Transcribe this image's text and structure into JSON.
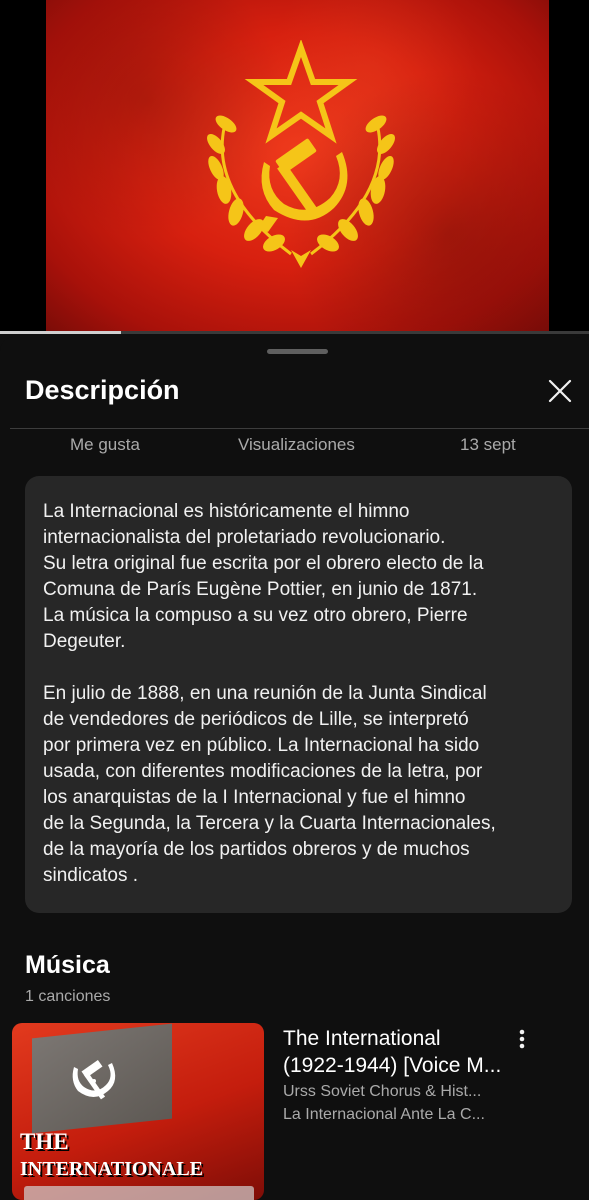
{
  "video": {
    "progress_fraction": 0.205,
    "thumbnail_icon": "hammer-and-sickle-icon"
  },
  "sheet": {
    "title": "Descripción",
    "close_icon": "close-icon"
  },
  "stats": {
    "likes_label": "Me gusta",
    "views_label": "Visualizaciones",
    "date": "13 sept"
  },
  "description": {
    "paragraphs": [
      "La Internacional es históricamente el himno internacionalista del proletariado revolucionario. Su letra original fue escrita por el obrero electo de la Comuna de París Eugène Pottier, en junio de 1871. La música la compuso a su vez otro obrero, Pierre Degeuter.",
      "En julio de 1888, en una reunión de la Junta Sindical de vendedores de periódicos de Lille, se interpretó por primera vez en público. La Internacional ha sido usada, con diferentes modificaciones de la letra, por los anarquistas de la I Internacional y fue el himno de la Segunda, la Tercera y la Cuarta Internacionales, de la mayoría de los partidos obreros y de muchos sindicatos ."
    ],
    "lines1": [
      "La Internacional es históricamente el himno",
      "internacionalista del proletariado revolucionario.",
      "Su letra original fue escrita por el obrero electo de la",
      "Comuna de París Eugène Pottier, en junio de 1871.",
      "La música la compuso a su vez otro obrero, Pierre",
      "Degeuter."
    ],
    "lines2": [
      "En julio de 1888, en una reunión de la Junta Sindical",
      "de vendedores de periódicos de Lille, se interpretó",
      "por primera vez en público. La Internacional ha sido",
      "usada, con diferentes modificaciones de la letra, por",
      "los anarquistas de la I Internacional y fue el himno",
      "de la Segunda, la Tercera y la Cuarta Internacionales,",
      "de la mayoría de los partidos obreros y de muchos",
      "sindicatos ."
    ]
  },
  "music": {
    "heading": "Música",
    "count": "1 canciones",
    "track": {
      "title_line1": "The International",
      "title_line2": "(1922-1944) [Voice M...",
      "artist": "Urss Soviet Chorus & Hist...",
      "album": "La Internacional Ante La C...",
      "thumb_text_the": "THE",
      "thumb_text_internationale": "INTERNATIONALE",
      "more_icon": "more-vert-icon"
    }
  },
  "colors": {
    "background": "#0f0f0f",
    "card": "#272727",
    "flag_red": "#d7200f",
    "emblem_gold": "#f5c518",
    "secondary_text": "#aaaaaa"
  }
}
